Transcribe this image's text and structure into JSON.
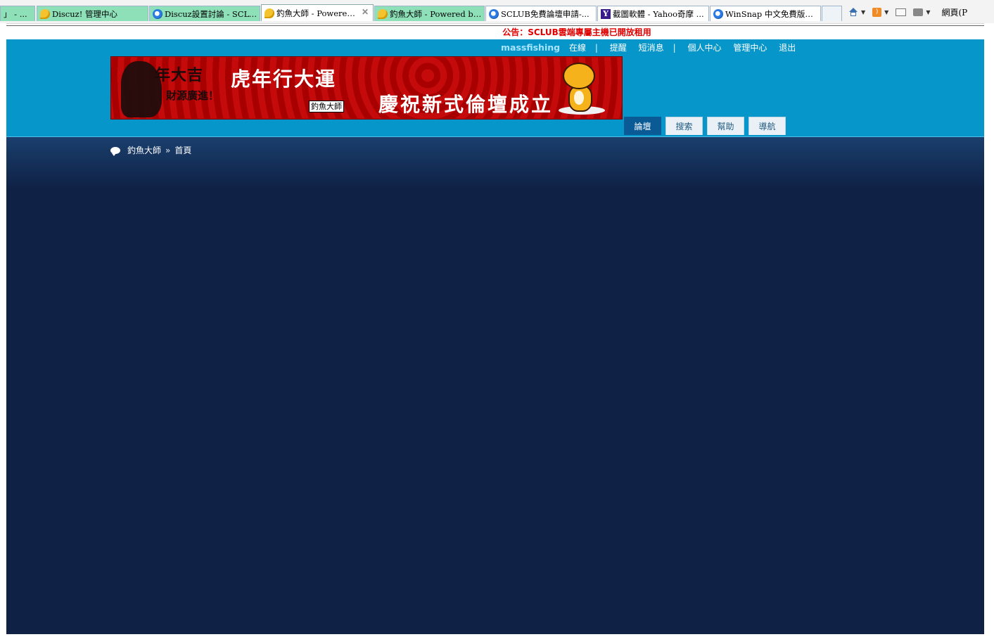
{
  "browser": {
    "tabs": [
      {
        "label": "」 - ...",
        "style": "green",
        "icon": "none"
      },
      {
        "label": "Discuz! 管理中心",
        "style": "green",
        "icon": "chat-bubble-icon"
      },
      {
        "label": "Discuz設置討論 - SCLU...",
        "style": "green",
        "icon": "ie-icon"
      },
      {
        "label": "釣魚大師 - Powered ...",
        "style": "active",
        "icon": "chat-bubble-icon"
      },
      {
        "label": "釣魚大師 - Powered by ...",
        "style": "green",
        "icon": "chat-bubble-icon"
      },
      {
        "label": "SCLUB免費論壇申請-...",
        "style": "white",
        "icon": "ie-icon"
      },
      {
        "label": "截圖軟體 - Yahoo奇摩 ...",
        "style": "white",
        "icon": "yahoo-icon"
      },
      {
        "label": "WinSnap 中文免費版，...",
        "style": "white",
        "icon": "ie-icon"
      }
    ],
    "active_close_glyph": "✕",
    "page_menu_label": "網頁(P"
  },
  "page": {
    "announcement": "公告：SCLUB雲端專屬主機已開放租用",
    "userbar": {
      "username": "massfishing",
      "links": [
        "在線",
        "提醒",
        "短消息",
        "個人中心",
        "管理中心",
        "退出"
      ]
    },
    "banner": {
      "headline_1": "虎年行大運",
      "headline_2": "慶祝新式倫壇成立",
      "new_year_1": "年大吉",
      "new_year_2": "財源廣進！",
      "tag": "釣魚大師"
    },
    "nav_tabs": [
      "論壇",
      "搜索",
      "幫助",
      "導航"
    ],
    "breadcrumb": {
      "site": "釣魚大師",
      "separator": "»",
      "current": "首頁"
    }
  },
  "colors": {
    "header_bg": "#0796c9",
    "body_bg": "#0f2246",
    "announcement_text": "#e00000",
    "active_tab_bg": "#0a5a96"
  }
}
